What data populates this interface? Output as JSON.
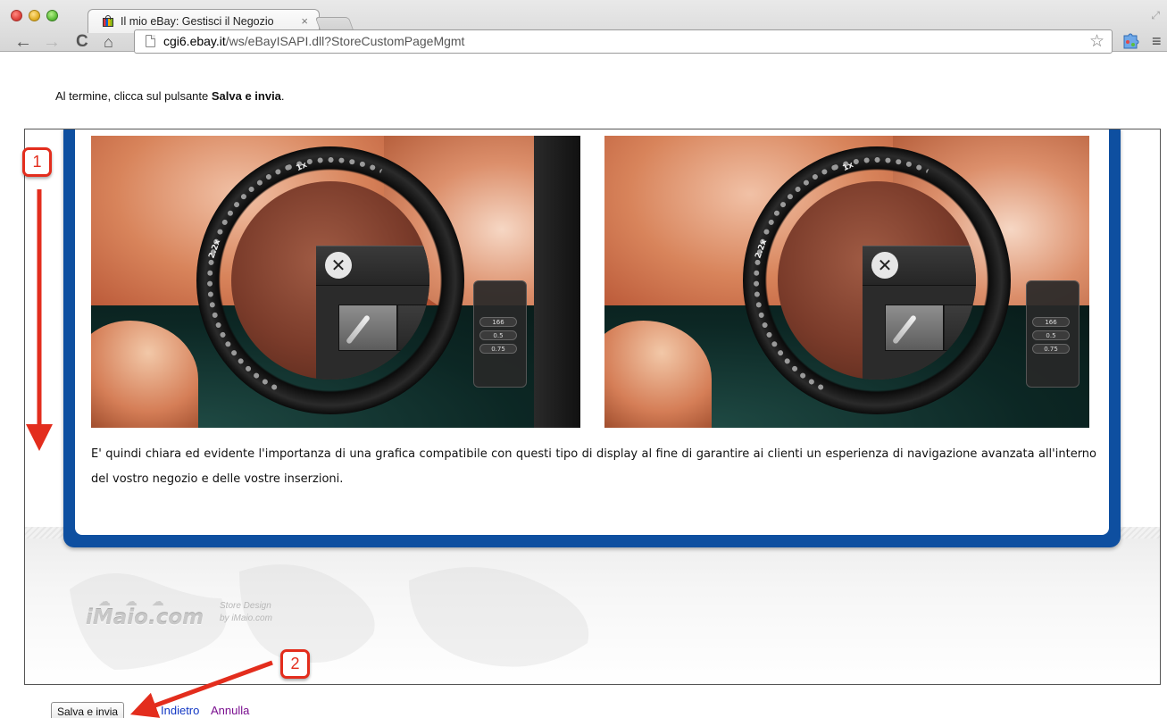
{
  "browser": {
    "tab_title": "Il mio eBay: Gestisci il Negozio",
    "tab_close": "×",
    "url_host": "cgi6.ebay.it",
    "url_path": "/ws/eBayISAPI.dll?StoreCustomPageMgmt",
    "nav": {
      "back": "←",
      "forward": "→",
      "reload": "C",
      "home": "⌂"
    },
    "star": "☆",
    "menu": "≡",
    "resize": "⤢"
  },
  "page": {
    "instruction_prefix": "Al termine, clicca sul pulsante ",
    "instruction_bold": "Salva e invia",
    "instruction_suffix": "."
  },
  "preview": {
    "lens_left": {
      "zoom_max": "2.2x",
      "zoom_min": "1x",
      "close": "✕"
    },
    "lens_right": {
      "zoom_max": "2.2x",
      "zoom_min": "1x",
      "close": "✕"
    },
    "hud_values": [
      "166",
      "0.5",
      "0.75"
    ],
    "description": "E' quindi chiara ed evidente l'importanza di una grafica compatibile con questi tipo di display al fine di garantire ai clienti un esperienza di navigazione avanzata all'interno del vostro negozio e delle vostre inserzioni.",
    "brand": {
      "name": "iMaio.com",
      "tagline_1": "Store Design",
      "tagline_2": "by iMaio.com"
    }
  },
  "annotations": {
    "step_1": "1",
    "step_2": "2",
    "color": "#e32d1d"
  },
  "actions": {
    "save": "Salva e invia",
    "back": "Indietro",
    "cancel": "Annulla"
  }
}
